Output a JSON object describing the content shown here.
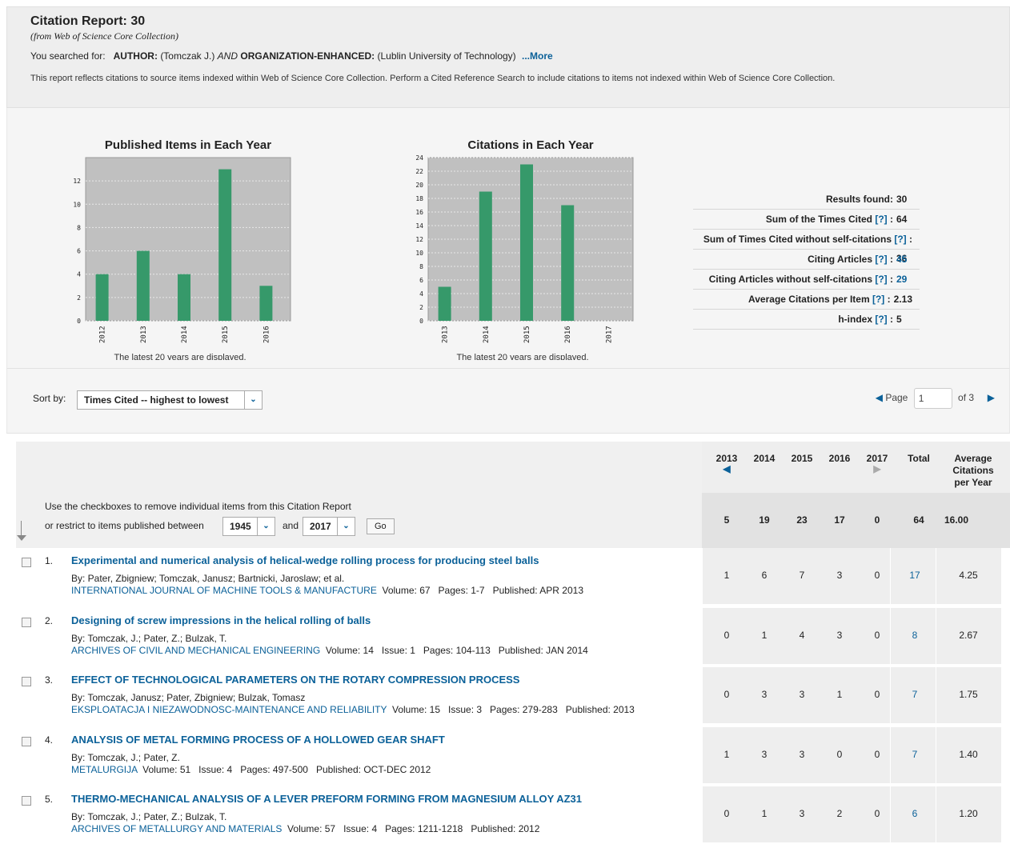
{
  "report": {
    "title": "Citation Report: 30",
    "source": "(from Web of Science Core Collection)",
    "searched_prefix": "You searched for:",
    "q_author_key": "AUTHOR:",
    "q_author_val": "(Tomczak J.)",
    "q_and": "AND",
    "q_org_key": "ORGANIZATION-ENHANCED:",
    "q_org_val": "(Lublin University of Technology)",
    "more_link": "...More",
    "note": "This report reflects citations to source items indexed within Web of Science Core Collection. Perform a Cited Reference Search to include citations to items not indexed within Web of Science Core Collection."
  },
  "chart_data": [
    {
      "type": "bar",
      "title": "Published Items in Each Year",
      "categories": [
        "2012",
        "2013",
        "2014",
        "2015",
        "2016"
      ],
      "values": [
        4,
        6,
        4,
        13,
        3
      ],
      "ylim": [
        0,
        14
      ],
      "yticks": [
        0,
        2,
        4,
        6,
        8,
        10,
        12
      ],
      "caption": "The latest 20 years are displayed.",
      "bar_color": "#36996a",
      "plot_bg": "#c0c0c0"
    },
    {
      "type": "bar",
      "title": "Citations in Each Year",
      "categories": [
        "2013",
        "2014",
        "2015",
        "2016",
        "2017"
      ],
      "values": [
        5,
        19,
        23,
        17,
        0
      ],
      "ylim": [
        0,
        24
      ],
      "yticks": [
        0,
        2,
        4,
        6,
        8,
        10,
        12,
        14,
        16,
        18,
        20,
        22,
        24
      ],
      "caption": "The latest 20 years are displayed.",
      "bar_color": "#36996a",
      "plot_bg": "#c0c0c0"
    }
  ],
  "stats": [
    {
      "label": "Results found:",
      "help": "",
      "value": "30",
      "link": false
    },
    {
      "label": "Sum of the Times Cited",
      "help": "[?]",
      "value": "64",
      "link": false
    },
    {
      "label": "Sum of Times Cited without self-citations",
      "help": "[?]",
      "value": "36",
      "link": false
    },
    {
      "label": "Citing Articles",
      "help": "[?]",
      "value": "45",
      "link": true
    },
    {
      "label": "Citing Articles without self-citations",
      "help": "[?]",
      "value": "29",
      "link": true
    },
    {
      "label": "Average Citations per Item",
      "help": "[?]",
      "value": "2.13",
      "link": false
    },
    {
      "label": "h-index",
      "help": "[?]",
      "value": "5",
      "link": false
    }
  ],
  "sort": {
    "label": "Sort by:",
    "selected": "Times Cited -- highest to lowest"
  },
  "pager": {
    "page_label": "Page",
    "current": "1",
    "of_label": "of",
    "total": "3"
  },
  "table": {
    "instruction": "Use the checkboxes to remove individual items from this Citation Report",
    "restrict_label": "or restrict to items published between",
    "from_year": "1945",
    "and_label": "and",
    "to_year": "2017",
    "go_label": "Go",
    "year_headers": [
      "2013",
      "2014",
      "2015",
      "2016",
      "2017"
    ],
    "total_header": "Total",
    "avg_header_1": "Average",
    "avg_header_2": "Citations",
    "avg_header_3": "per Year",
    "totals": [
      "5",
      "19",
      "23",
      "17",
      "0",
      "64",
      "16.00"
    ],
    "rows": [
      {
        "num": "1.",
        "title": "Experimental and numerical analysis of helical-wedge rolling process for producing steel balls",
        "authors": "By: Pater, Zbigniew; Tomczak, Janusz; Bartnicki, Jaroslaw; et al.",
        "journal": "INTERNATIONAL JOURNAL OF MACHINE TOOLS & MANUFACTURE",
        "details": "Volume: 67   Pages: 1-7   Published: APR 2013",
        "years": [
          "1",
          "6",
          "7",
          "3",
          "0"
        ],
        "total": "17",
        "avg": "4.25"
      },
      {
        "num": "2.",
        "title": "Designing of screw impressions in the helical rolling of balls",
        "authors": "By: Tomczak, J.; Pater, Z.; Bulzak, T.",
        "journal": "ARCHIVES OF CIVIL AND MECHANICAL ENGINEERING",
        "details": "Volume: 14   Issue: 1   Pages: 104-113   Published: JAN 2014",
        "years": [
          "0",
          "1",
          "4",
          "3",
          "0"
        ],
        "total": "8",
        "avg": "2.67"
      },
      {
        "num": "3.",
        "title": "EFFECT OF TECHNOLOGICAL PARAMETERS ON THE ROTARY COMPRESSION PROCESS",
        "authors": "By: Tomczak, Janusz; Pater, Zbigniew; Bulzak, Tomasz",
        "journal": "EKSPLOATACJA I NIEZAWODNOSC-MAINTENANCE AND RELIABILITY",
        "details": "Volume: 15   Issue: 3   Pages: 279-283   Published: 2013",
        "years": [
          "0",
          "3",
          "3",
          "1",
          "0"
        ],
        "total": "7",
        "avg": "1.75"
      },
      {
        "num": "4.",
        "title": "ANALYSIS OF METAL FORMING PROCESS OF A HOLLOWED GEAR SHAFT",
        "authors": "By: Tomczak, J.; Pater, Z.",
        "journal": "METALURGIJA",
        "details": "Volume: 51   Issue: 4   Pages: 497-500   Published: OCT-DEC 2012",
        "years": [
          "1",
          "3",
          "3",
          "0",
          "0"
        ],
        "total": "7",
        "avg": "1.40"
      },
      {
        "num": "5.",
        "title": "THERMO-MECHANICAL ANALYSIS OF A LEVER PREFORM FORMING FROM MAGNESIUM ALLOY AZ31",
        "authors": "By: Tomczak, J.; Pater, Z.; Bulzak, T.",
        "journal": "ARCHIVES OF METALLURGY AND MATERIALS",
        "details": "Volume: 57   Issue: 4   Pages: 1211-1218   Published: 2012",
        "years": [
          "0",
          "1",
          "3",
          "2",
          "0"
        ],
        "total": "6",
        "avg": "1.20"
      }
    ]
  }
}
